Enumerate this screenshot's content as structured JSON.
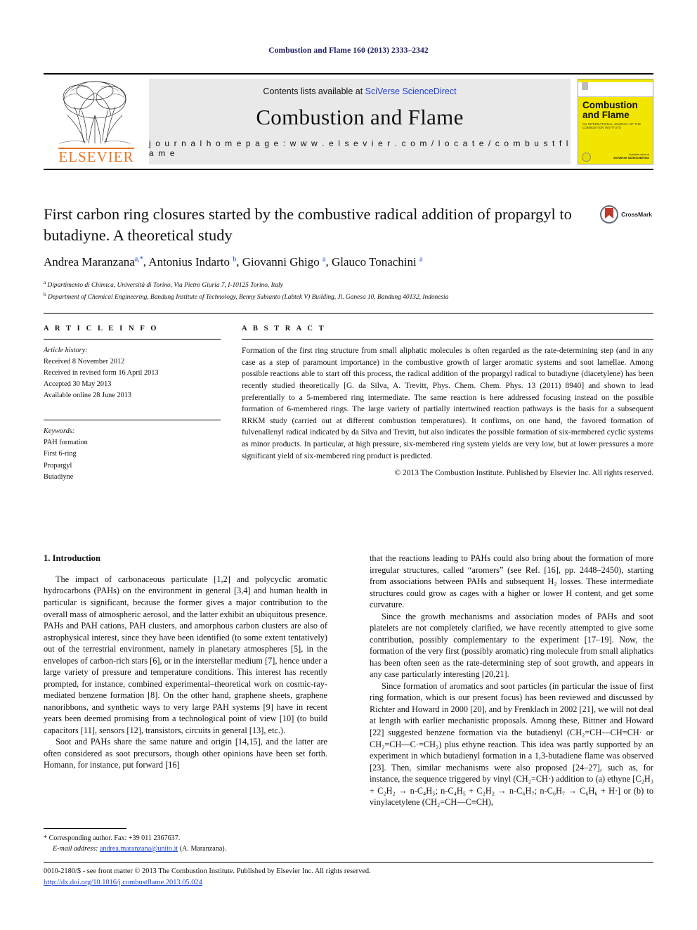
{
  "running_head": "Combustion and Flame 160 (2013) 2333–2342",
  "masthead": {
    "contents_prefix": "Contents lists available at ",
    "contents_link": "SciVerse ScienceDirect",
    "journal_title": "Combustion and Flame",
    "homepage": "j o u r n a l   h o m e p a g e :   w w w . e l s e v i e r . c o m / l o c a t e / c o m b u s t f l a m e",
    "publisher_word": "ELSEVIER",
    "cover": {
      "name_line1": "Combustion",
      "name_line2": "and Flame",
      "subtitle": "AN INTERNATIONAL JOURNAL OF THE COMBUSTION INSTITUTE",
      "bottom_text_small": "Available online at",
      "bottom_text_bold": "SciVerse ScienceDirect"
    }
  },
  "article": {
    "title": "First carbon ring closures started by the combustive radical addition of propargyl to butadiyne. A theoretical study",
    "crossmark_label": "CrossMark",
    "authors_html": "Andrea Maranzana <sup>a,*</sup>, Antonius Indarto <sup>b</sup>, Giovanni Ghigo <sup>a</sup>, Glauco Tonachini <sup>a</sup>",
    "affiliation_a": "Dipartimento di Chimica, Università di Torino, Via Pietro Giuria 7, I-10125 Torino, Italy",
    "affiliation_b": "Department of Chemical Engineering, Bandung Institute of Technology, Benny Subianto (Labtek V) Building, Jl. Ganesa 10, Bandung 40132, Indonesia"
  },
  "article_info": {
    "heading": "A R T I C L E   I N F O",
    "history_label": "Article history:",
    "history": [
      "Received 8 November 2012",
      "Received in revised form 16 April 2013",
      "Accepted 30 May 2013",
      "Available online 28 June 2013"
    ],
    "keywords_label": "Keywords:",
    "keywords": [
      "PAH formation",
      "First 6-ring",
      "Propargyl",
      "Butadiyne"
    ]
  },
  "abstract": {
    "heading": "A B S T R A C T",
    "text": "Formation of the first ring structure from small aliphatic molecules is often regarded as the rate-determining step (and in any case as a step of paramount importance) in the combustive growth of larger aromatic systems and soot lamellae. Among possible reactions able to start off this process, the radical addition of the propargyl radical to butadiyne (diacetylene) has been recently studied theoretically [G. da Silva, A. Trevitt, Phys. Chem. Chem. Phys. 13 (2011) 8940] and shown to lead preferentially to a 5-membered ring intermediate. The same reaction is here addressed focusing instead on the possible formation of 6-membered rings. The large variety of partially intertwined reaction pathways is the basis for a subsequent RRKM study (carried out at different combustion temperatures). It confirms, on one hand, the favored formation of fulvenallenyl radical indicated by da Silva and Trevitt, but also indicates the possible formation of six-membered cyclic systems as minor products. In particular, at high pressure, six-membered ring system yields are very low, but at lower pressures a more significant yield of six-membered ring product is predicted.",
    "copyright": "© 2013 The Combustion Institute. Published by Elsevier Inc. All rights reserved."
  },
  "body": {
    "section_heading": "1. Introduction",
    "left_paragraphs": [
      "The impact of carbonaceous particulate [1,2] and polycyclic aromatic hydrocarbons (PAHs) on the environment in general [3,4] and human health in particular is significant, because the former gives a major contribution to the overall mass of atmospheric aerosol, and the latter exhibit an ubiquitous presence. PAHs and PAH cations, PAH clusters, and amorphous carbon clusters are also of astrophysical interest, since they have been identified (to some extent tentatively) out of the terrestrial environment, namely in planetary atmospheres [5], in the envelopes of carbon-rich stars [6], or in the interstellar medium [7], hence under a large variety of pressure and temperature conditions. This interest has recently prompted, for instance, combined experimental–theoretical work on cosmic-ray-mediated benzene formation [8]. On the other hand, graphene sheets, graphene nanoribbons, and synthetic ways to very large PAH systems [9] have in recent years been deemed promising from a technological point of view [10] (to build capacitors [11], sensors [12], transistors, circuits in general [13], etc.).",
      "Soot and PAHs share the same nature and origin [14,15], and the latter are often considered as soot precursors, though other opinions have been set forth. Homann, for instance, put forward [16]"
    ],
    "right_paragraphs": [
      "that the reactions leading to PAHs could also bring about the formation of more irregular structures, called “aromers” (see Ref. [16], pp. 2448–2450), starting from associations between PAHs and subsequent H₂ losses. These intermediate structures could grow as cages with a higher or lower H content, and get some curvature.",
      "Since the growth mechanisms and association modes of PAHs and soot platelets are not completely clarified, we have recently attempted to give some contribution, possibly complementary to the experiment [17–19]. Now, the formation of the very first (possibly aromatic) ring molecule from small aliphatics has been often seen as the rate-determining step of soot growth, and appears in any case particularly interesting [20,21].",
      "Since formation of aromatics and soot particles (in particular the issue of first ring formation, which is our present focus) has been reviewed and discussed by Richter and Howard in 2000 [20], and by Frenklach in 2002 [21], we will not deal at length with earlier mechanistic proposals. Among these, Bittner and Howard [22] suggested benzene formation via the butadienyl (CH₂=CH—CH=CH· or CH₂=CH—C·=CH₂) plus ethyne reaction. This idea was partly supported by an experiment in which butadienyl formation in a 1,3-butadiene flame was observed [23]. Then, similar mechanisms were also proposed [24–27], such as, for instance, the sequence triggered by vinyl (CH₂=CH·) addition to (a) ethyne [C₂H₃ + C₂H₂ → n-C₄H₅; n-C₄H₅ + C₂H₂ → n-C₆H₇; n-C₆H₇ → C₆H₆ + H·] or (b) to vinylacetylene (CH₂=CH—C≡CH),"
    ]
  },
  "footnote": {
    "star": "*",
    "corresponding": "Corresponding author. Fax: +39 011 2367637.",
    "email_label": "E-mail address:",
    "email": "andrea.maranzana@unito.it",
    "email_suffix": "(A. Maranzana)."
  },
  "footer": {
    "line1": "0010-2180/$ - see front matter © 2013 The Combustion Institute. Published by Elsevier Inc. All rights reserved.",
    "doi": "http://dx.doi.org/10.1016/j.combustflame.2013.05.024"
  },
  "colors": {
    "link": "#1a3fd4",
    "running_head": "#1a1a5e",
    "elsevier_orange": "#E87722",
    "cover_yellow": "#f2e600",
    "masthead_grey": "#e9e9e9"
  }
}
